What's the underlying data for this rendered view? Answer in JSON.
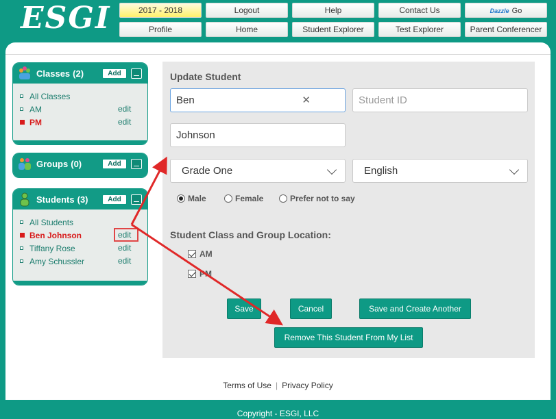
{
  "header": {
    "logo": "ESGI",
    "nav_top": [
      "2017 - 2018",
      "Logout",
      "Help",
      "Contact Us"
    ],
    "dazzle": {
      "brand": "Dazzle",
      "go": "Go"
    },
    "nav_bottom": [
      "Profile",
      "Home",
      "Student Explorer",
      "Test Explorer",
      "Parent Conferencer"
    ]
  },
  "sidebar": {
    "classes": {
      "title": "Classes",
      "count": "(2)",
      "add": "Add",
      "items": [
        {
          "label": "All Classes",
          "edit": ""
        },
        {
          "label": "AM",
          "edit": "edit"
        },
        {
          "label": "PM",
          "edit": "edit"
        }
      ]
    },
    "groups": {
      "title": "Groups",
      "count": "(0)",
      "add": "Add"
    },
    "students": {
      "title": "Students",
      "count": "(3)",
      "add": "Add",
      "items": [
        {
          "label": "All Students",
          "edit": ""
        },
        {
          "label": "Ben Johnson",
          "edit": "edit"
        },
        {
          "label": "Tiffany Rose",
          "edit": "edit"
        },
        {
          "label": "Amy Schussler",
          "edit": "edit"
        }
      ]
    }
  },
  "form": {
    "title": "Update Student",
    "first_name": "Ben",
    "student_id_placeholder": "Student ID",
    "last_name": "Johnson",
    "grade": "Grade One",
    "language": "English",
    "gender_options": [
      "Male",
      "Female",
      "Prefer not to say"
    ],
    "gender_selected": "Male",
    "location_title": "Student Class and Group Location:",
    "locations": [
      "AM",
      "PM"
    ],
    "save": "Save",
    "cancel": "Cancel",
    "save_another": "Save and Create Another",
    "remove": "Remove This Student From My List"
  },
  "footer": {
    "terms": "Terms of Use",
    "separator": "|",
    "privacy": "Privacy Policy",
    "copyright": "Copyright - ESGI, LLC"
  },
  "colors": {
    "teal": "#0e9a85",
    "active_red": "#d81b1b",
    "arrow_red": "#e02828",
    "year_yellow": "#fff16a"
  }
}
